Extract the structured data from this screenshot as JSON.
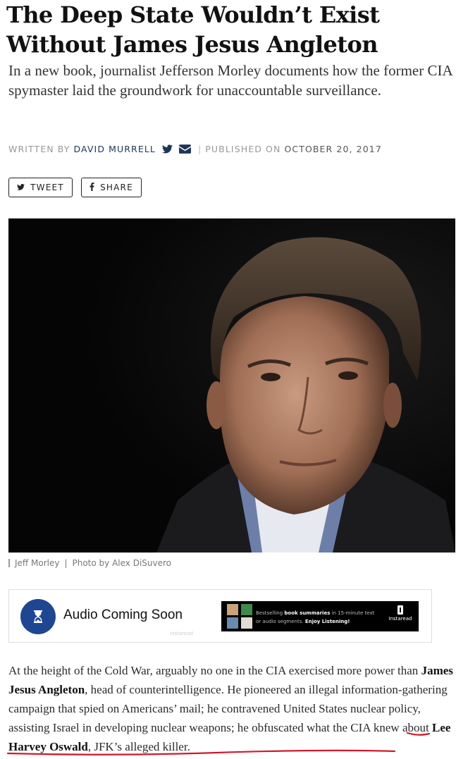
{
  "article": {
    "title": "The Deep State Wouldn’t Exist Without James Jesus Angleton",
    "dek": "In a new book, journalist Jefferson Morley documents how the former CIA spymaster laid the groundwork for unaccountable surveillance.",
    "byline": {
      "written_by_label": "WRITTEN BY",
      "author": "DAVID MURRELL",
      "separator": "|",
      "published_label": "PUBLISHED ON",
      "date": "OCTOBER 20, 2017"
    },
    "share": {
      "tweet_label": "TWEET",
      "share_label": "SHARE"
    },
    "photo_caption": {
      "subject": "Jeff Morley",
      "separator": "|",
      "credit": "Photo by Alex DiSuvero"
    },
    "audio": {
      "label": "Audio Coming Soon",
      "credit": "Instaread",
      "ad": {
        "text_1": "Bestselling ",
        "text_bold_1": "book summaries",
        "text_2": " in 15-minute text",
        "text_3": "or audio segments. ",
        "text_bold_2": "Enjoy Listening!",
        "logo": "Instaread"
      }
    },
    "body": {
      "t1": "At the height of the Cold War, arguably no one in the CIA exercised more power than ",
      "b1": "James Jesus Angleton",
      "t2": ", head of counterintelligence. He pioneered an illegal information-gathering campaign that spied on Americans’ mail; he contravened United States nuclear policy, assisting Israel in developing nuclear weapons; he obfuscated what the CIA knew about ",
      "b2": "Lee Harvey Oswald",
      "t3": ", JFK’s alleged killer."
    }
  },
  "colors": {
    "author_link": "#1d3557",
    "audio_icon_bg": "#1f4690",
    "underline_annotation": "#d11a2a"
  },
  "icons": [
    "twitter-icon",
    "email-icon",
    "facebook-icon",
    "hourglass-icon"
  ]
}
